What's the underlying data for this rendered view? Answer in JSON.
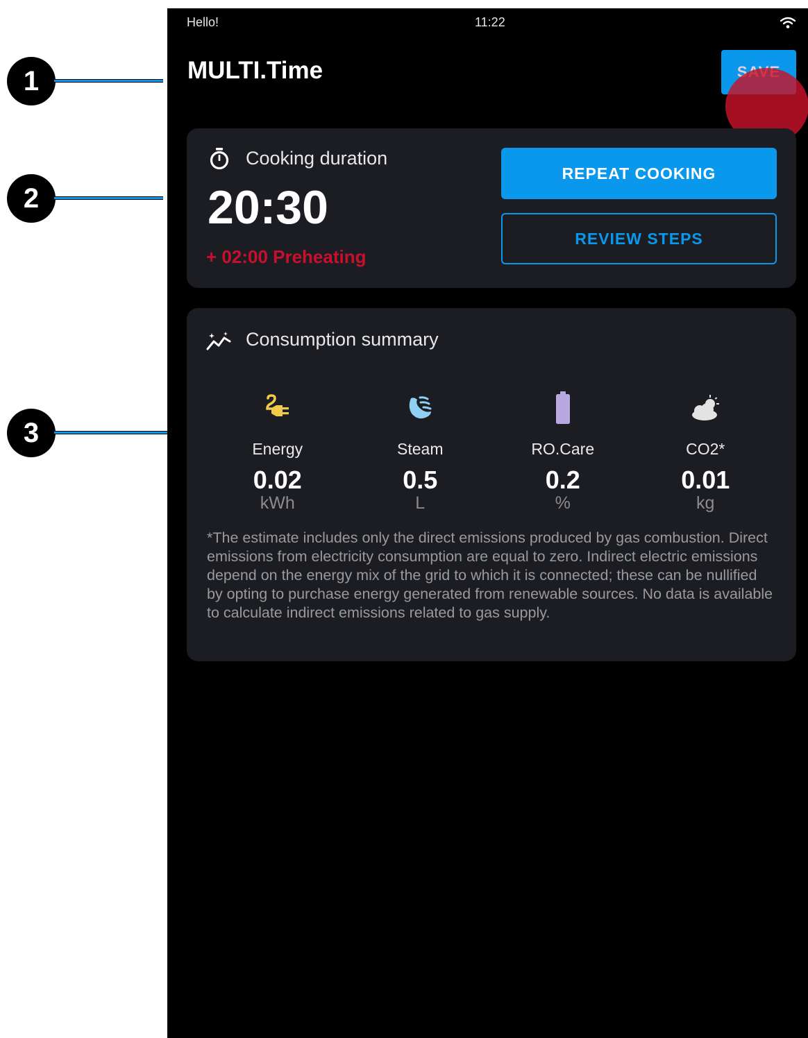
{
  "callouts": [
    "1",
    "2",
    "3"
  ],
  "status_bar": {
    "greeting": "Hello!",
    "time": "11:22",
    "wifi_icon": "wifi-icon"
  },
  "header": {
    "title": "MULTI.Time",
    "save_label": "SAVE"
  },
  "duration_card": {
    "title": "Cooking duration",
    "icon": "timer-icon",
    "duration": "20:30",
    "preheating": "+ 02:00 Preheating",
    "repeat_label": "REPEAT COOKING",
    "review_label": "REVIEW STEPS"
  },
  "consumption_card": {
    "title": "Consumption summary",
    "icon": "chart-icon",
    "metrics": [
      {
        "icon": "energy-plug-icon",
        "label": "Energy",
        "value": "0.02",
        "unit": "kWh",
        "color": "#f2c94c"
      },
      {
        "icon": "steam-icon",
        "label": "Steam",
        "value": "0.5",
        "unit": "L",
        "color": "#8fd0f5"
      },
      {
        "icon": "battery-icon",
        "label": "RO.Care",
        "value": "0.2",
        "unit": "%",
        "color": "#b9a7e0"
      },
      {
        "icon": "cloud-icon",
        "label": "CO2*",
        "value": "0.01",
        "unit": "kg",
        "color": "#e3e3e3"
      }
    ],
    "disclaimer": "*The estimate includes only the direct emissions produced by gas combustion. Direct emissions from electricity consumption are equal to zero. Indirect electric emissions depend on the energy mix of the grid to which it is connected; these can be nullified by opting to purchase energy generated from renewable sources. No data is available to calculate indirect emissions related to gas supply."
  },
  "colors": {
    "accent": "#0a98ec",
    "preheat": "#c8102e",
    "card": "#1c1d22",
    "background": "#000000"
  }
}
